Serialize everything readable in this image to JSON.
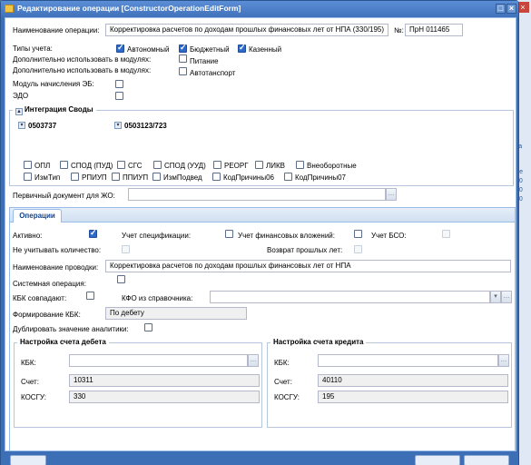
{
  "window": {
    "title": "Редактирование операции [ConstructorOperationEditForm]"
  },
  "top": {
    "name_label": "Наименование операции:",
    "name_value": "Корректировка расчетов по доходам прошлых финансовых лет от НПА (330/195)",
    "num_label": "№:",
    "num_value": "ПрН 011465"
  },
  "accounting": {
    "label": "Типы учета:",
    "autonomous": "Автономный",
    "budget": "Бюджетный",
    "treasury": "Казенный"
  },
  "modules": {
    "label1": "Дополнительно использовать в модулях:",
    "label2": "Дополнительно использовать в модулях:",
    "food": "Питание",
    "auto": "Автотанспорт",
    "eb_label": "Модуль начисления ЭБ:",
    "edo_label": "ЭДО"
  },
  "integration": {
    "legend": "Интеграция Своды",
    "sel1": "0503737",
    "sel2": "0503123/723",
    "row1": [
      "ОПЛ",
      "СПОД (ПУД)",
      "СГС",
      "СПОД (УУД)",
      "РЕОРГ",
      "ЛИКВ",
      "Внеоборотные"
    ],
    "row2": [
      "ИзмТип",
      "РПИУП",
      "ППИУП",
      "ИзмПодвед",
      "КодПричины06",
      "КодПричины07"
    ]
  },
  "primary_doc": {
    "label": "Первичный документ для ЖО:",
    "value": ""
  },
  "tab": {
    "label": "Операции"
  },
  "ops": {
    "active": "Активно:",
    "spec": "Учет спецификации:",
    "fin": "Учет финансовых вложений:",
    "bso": "Учет БСО:",
    "ignore_qty": "Не учитывать количество:",
    "prior_years": "Возврат прошлых лет:",
    "wiring_label": "Наименование проводки:",
    "wiring_value": "Корректировка расчетов по доходам прошлых финансовых лет от НПА",
    "system": "Системная операция:",
    "kbk_match": "КБК совпадают:",
    "kfo_label": "КФО из справочника:",
    "kfo_value": "",
    "form_kbk_label": "Формирование КБК:",
    "form_kbk_value": "По дебету",
    "dup_label": "Дублировать значение аналитики:"
  },
  "debit": {
    "legend": "Настройка счета дебета",
    "kbk_label": "КБК:",
    "kbk_value": "",
    "account_label": "Счет:",
    "account_value": "10311",
    "kosgu_label": "КОСГУ:",
    "kosgu_value": "330"
  },
  "credit": {
    "legend": "Настройка счета кредита",
    "kbk_label": "КБК:",
    "kbk_value": "",
    "account_label": "Счет:",
    "account_value": "40110",
    "kosgu_label": "КОСГУ:",
    "kosgu_value": "195"
  },
  "background": {
    "side_texts": [
      "ка",
      "де",
      "10",
      "10",
      "10"
    ]
  },
  "colors": {
    "titlebar": "#3f72bb",
    "checkbox_on": "#2e69c9",
    "tab_text": "#15428b"
  }
}
